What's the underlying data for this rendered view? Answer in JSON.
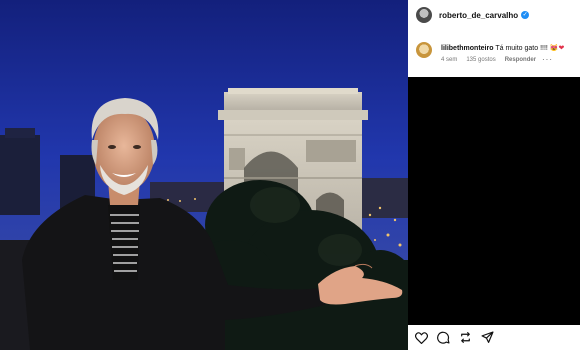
{
  "post": {
    "username": "roberto_de_carvalho",
    "verified_icon": "verified-badge-icon"
  },
  "comment": {
    "username": "lilibethmonteiro",
    "text": "Tá muito gato !!!!",
    "emoji": "😻❤",
    "time": "4 sem",
    "likes": "135 gostos",
    "reply": "Responder",
    "more": "···"
  },
  "actions": [
    "heart-icon",
    "comment-icon",
    "share-icon",
    "send-icon"
  ],
  "colors": {
    "sky": "#1d33a6",
    "verified": "#1f8ef5",
    "panel": "#000000"
  }
}
